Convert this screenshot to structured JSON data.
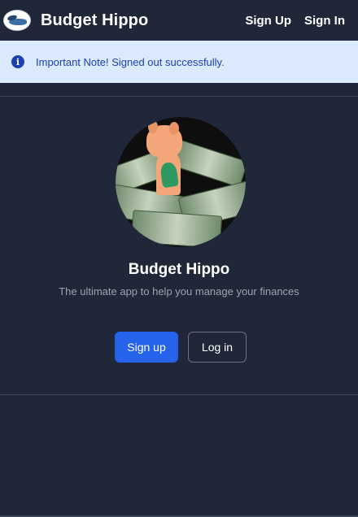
{
  "navbar": {
    "brand": "Budget Hippo",
    "links": [
      "Sign Up",
      "Sign In"
    ]
  },
  "alert": {
    "icon": "info-circle-icon",
    "text": "Important Note! Signed out successfully."
  },
  "hero": {
    "title": "Budget Hippo",
    "subtitle": "The ultimate app to help you manage your finances",
    "buttons": {
      "signup": "Sign up",
      "login": "Log in"
    }
  },
  "colors": {
    "background": "#1f2738",
    "primary": "#2563eb",
    "alert_bg": "#dbeafe",
    "alert_text": "#1e40af"
  }
}
